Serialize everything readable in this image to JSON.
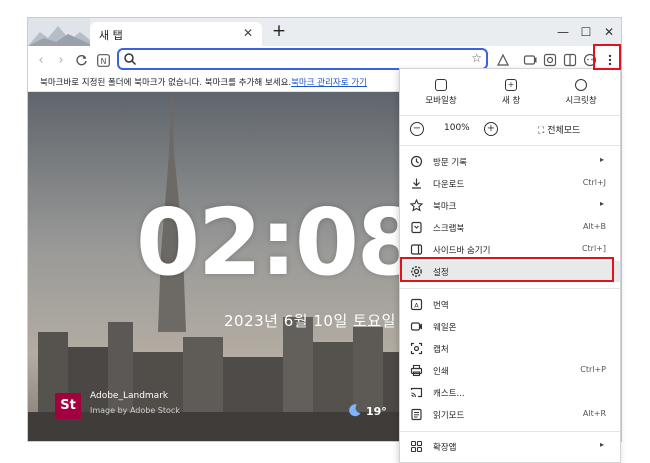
{
  "tabs": [
    {
      "title": "새 탭"
    }
  ],
  "toolbar": {
    "new_tab": "+"
  },
  "bookmarks_bar": {
    "message": "북마크바로 지정된 폴더에 북마크가 없습니다. 북마크를 추가해 보세요.",
    "link": "북마크 관리자로 가기"
  },
  "newtab_page": {
    "clock": "02:08",
    "date": "2023년 6월 10일 토요일",
    "attribution_logo": "St",
    "attribution_title": "Adobe_Landmark",
    "attribution_sub": "Image by Adobe Stock",
    "weather_temp": "19°"
  },
  "menu": {
    "top_actions": [
      {
        "label": "모바일창",
        "icon": "mobile-icon"
      },
      {
        "label": "새 창",
        "icon": "new-window-icon"
      },
      {
        "label": "시크릿창",
        "icon": "incognito-icon"
      }
    ],
    "zoom": {
      "value": "100%",
      "minus": "−",
      "plus": "+",
      "fullscreen": "전체모드"
    },
    "items": [
      {
        "label": "방문 기록",
        "shortcut": "",
        "submenu": true,
        "icon": "history-icon"
      },
      {
        "label": "다운로드",
        "shortcut": "Ctrl+J",
        "submenu": false,
        "icon": "download-icon"
      },
      {
        "label": "북마크",
        "shortcut": "",
        "submenu": true,
        "icon": "bookmark-star-icon"
      },
      {
        "label": "스크랩북",
        "shortcut": "Alt+B",
        "submenu": false,
        "icon": "scrapbook-icon"
      },
      {
        "label": "사이드바 숨기기",
        "shortcut": "Ctrl+]",
        "submenu": false,
        "icon": "sidebar-icon"
      },
      {
        "label": "설정",
        "shortcut": "",
        "submenu": false,
        "icon": "settings-gear-icon"
      },
      {
        "label": "번역",
        "shortcut": "",
        "submenu": false,
        "icon": "translate-icon"
      },
      {
        "label": "웨일온",
        "shortcut": "",
        "submenu": false,
        "icon": "whale-on-icon"
      },
      {
        "label": "캡처",
        "shortcut": "",
        "submenu": false,
        "icon": "capture-icon"
      },
      {
        "label": "인쇄",
        "shortcut": "Ctrl+P",
        "submenu": false,
        "icon": "print-icon"
      },
      {
        "label": "캐스트...",
        "shortcut": "",
        "submenu": false,
        "icon": "cast-icon"
      },
      {
        "label": "읽기모드",
        "shortcut": "Alt+R",
        "submenu": false,
        "icon": "reader-mode-icon"
      },
      {
        "label": "확장앱",
        "shortcut": "",
        "submenu": true,
        "icon": "extensions-icon"
      }
    ]
  },
  "colors": {
    "highlight": "#e0121b",
    "address_focus": "#3b63e0",
    "link": "#1a55d6"
  }
}
